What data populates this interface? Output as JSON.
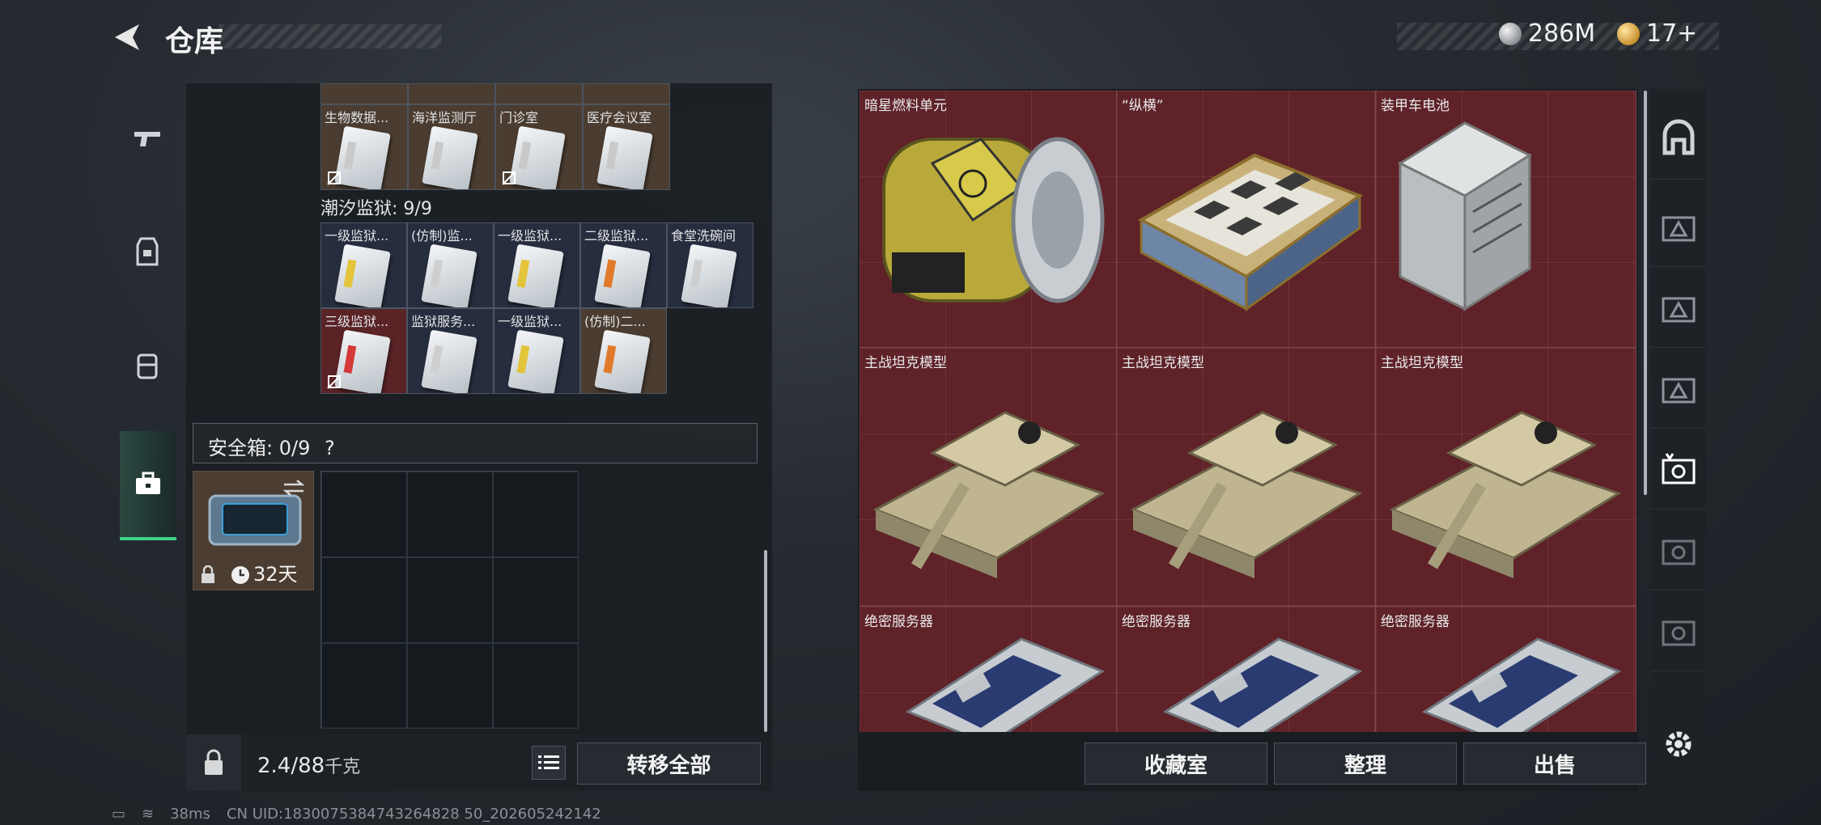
{
  "header": {
    "title": "仓库",
    "currency_1": "286M",
    "currency_2": "17+"
  },
  "left_tabs": [
    "weapon-tab",
    "armor-tab",
    "backpack-tab",
    "safebox-tab"
  ],
  "top_row_labels": [
    "生物数据...",
    "海洋监测厅",
    "门诊室",
    "医疗会议室"
  ],
  "prison": {
    "title": "潮汐监狱: 9/9",
    "row1": [
      "一级监狱...",
      "(仿制)监...",
      "一级监狱...",
      "二级监狱...",
      "食堂洗碗间"
    ],
    "row2": [
      "三级监狱...",
      "监狱服务...",
      "一级监狱...",
      "(仿制)二..."
    ]
  },
  "safebox": {
    "label": "安全箱: 0/9",
    "help": "?",
    "timer": "32天"
  },
  "weight": {
    "value": "2.4/88",
    "unit": "千克"
  },
  "buttons": {
    "transfer_all": "转移全部",
    "collection": "收藏室",
    "sort": "整理",
    "sell": "出售"
  },
  "items": {
    "row1": [
      "暗星燃料单元",
      "“纵横”",
      "装甲车电池"
    ],
    "row2": [
      "主战坦克模型",
      "主战坦克模型",
      "主战坦克模型"
    ],
    "row3": [
      "绝密服务器",
      "绝密服务器",
      "绝密服务器"
    ]
  },
  "status": {
    "ping": "38ms",
    "uid": "CN UID:1830075384743264828 50_202605242142"
  },
  "colors": {
    "accent_green": "#3ed28a",
    "item_red_bg": "#5e2228",
    "brown_bg": "#4a3c30"
  }
}
